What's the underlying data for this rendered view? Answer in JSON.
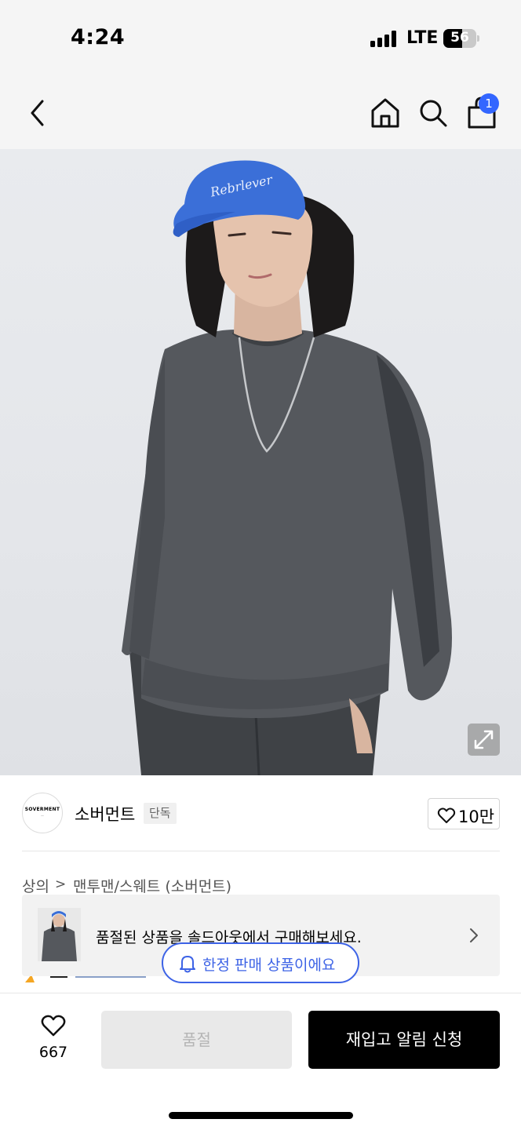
{
  "status_bar": {
    "time": "4:24",
    "network": "LTE",
    "battery": "56"
  },
  "nav": {
    "back_icon": "chevron-left-icon",
    "home_icon": "home-icon",
    "search_icon": "search-icon",
    "cart_icon": "shopping-bag-icon",
    "cart_count": "1"
  },
  "product_image": {
    "expand_icon": "expand-icon"
  },
  "brand": {
    "logo_text": "SOVERMENT",
    "name": "소버먼트",
    "tag": "단독",
    "like_count": "10만"
  },
  "breadcrumb": {
    "items": [
      "상의",
      "맨투맨/스웨트 (소버먼트)"
    ],
    "separator": ">"
  },
  "soldout_banner": {
    "text": "품절된 상품을 솔드아웃에서 구매해보세요."
  },
  "limited_badge": {
    "text": "한정 판매 상품이에요"
  },
  "bottom_bar": {
    "wish_count": "667",
    "soldout_label": "품절",
    "restock_label": "재입고 알림 신청"
  },
  "colors": {
    "accent_blue": "#3d63e6",
    "cart_badge": "#3366ff",
    "primary_button": "#000000",
    "disabled_button": "#e9e9e9"
  }
}
